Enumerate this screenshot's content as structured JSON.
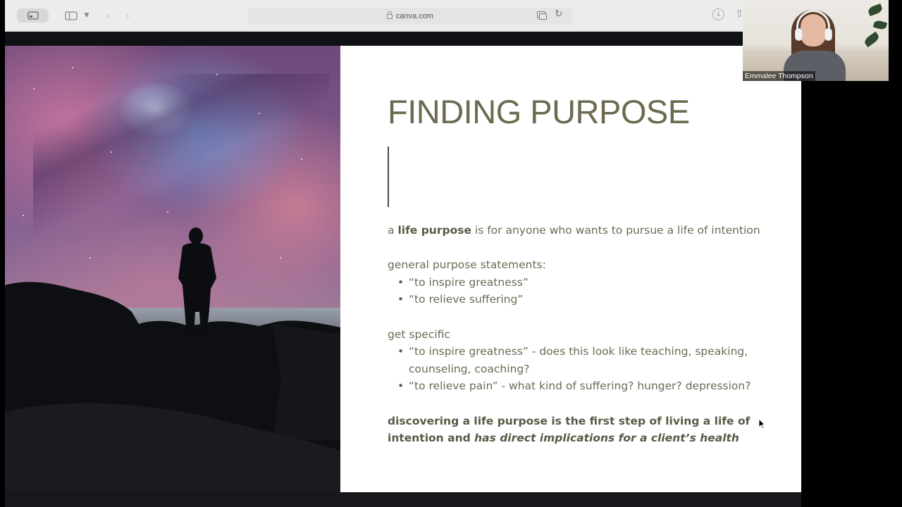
{
  "browser": {
    "url": "canva.com"
  },
  "slide": {
    "title": "FINDING PURPOSE",
    "intro": {
      "prefix": "a ",
      "bold": "life purpose",
      "suffix": " is for anyone who wants to pursue a life of intention"
    },
    "general": {
      "heading": "general purpose statements:",
      "bullets": [
        "“to inspire greatness”",
        "“to relieve suffering”"
      ]
    },
    "specific": {
      "heading": "get specific",
      "bullets": [
        "“to inspire greatness” - does this look like teaching, speaking, counseling, coaching?",
        "“to relieve pain” - what kind of suffering? hunger? depression?"
      ]
    },
    "conclusion": {
      "bold": "discovering a life purpose is the first step of living a life of intention and ",
      "italic": "has direct implications for a client’s health"
    },
    "colors": {
      "title": "#6c6a4f",
      "body": "#6b6a55",
      "background": "#ffffff"
    }
  },
  "video_call": {
    "participant_name": "Emmalee Thompson"
  },
  "icons": {
    "sidebar_toggle": "sidebar-icon",
    "lock": "lock-icon",
    "tabs": "tabs-icon",
    "reload": "reload-icon",
    "download": "download-icon",
    "share": "share-icon",
    "cursor": "mouse-pointer-icon"
  }
}
